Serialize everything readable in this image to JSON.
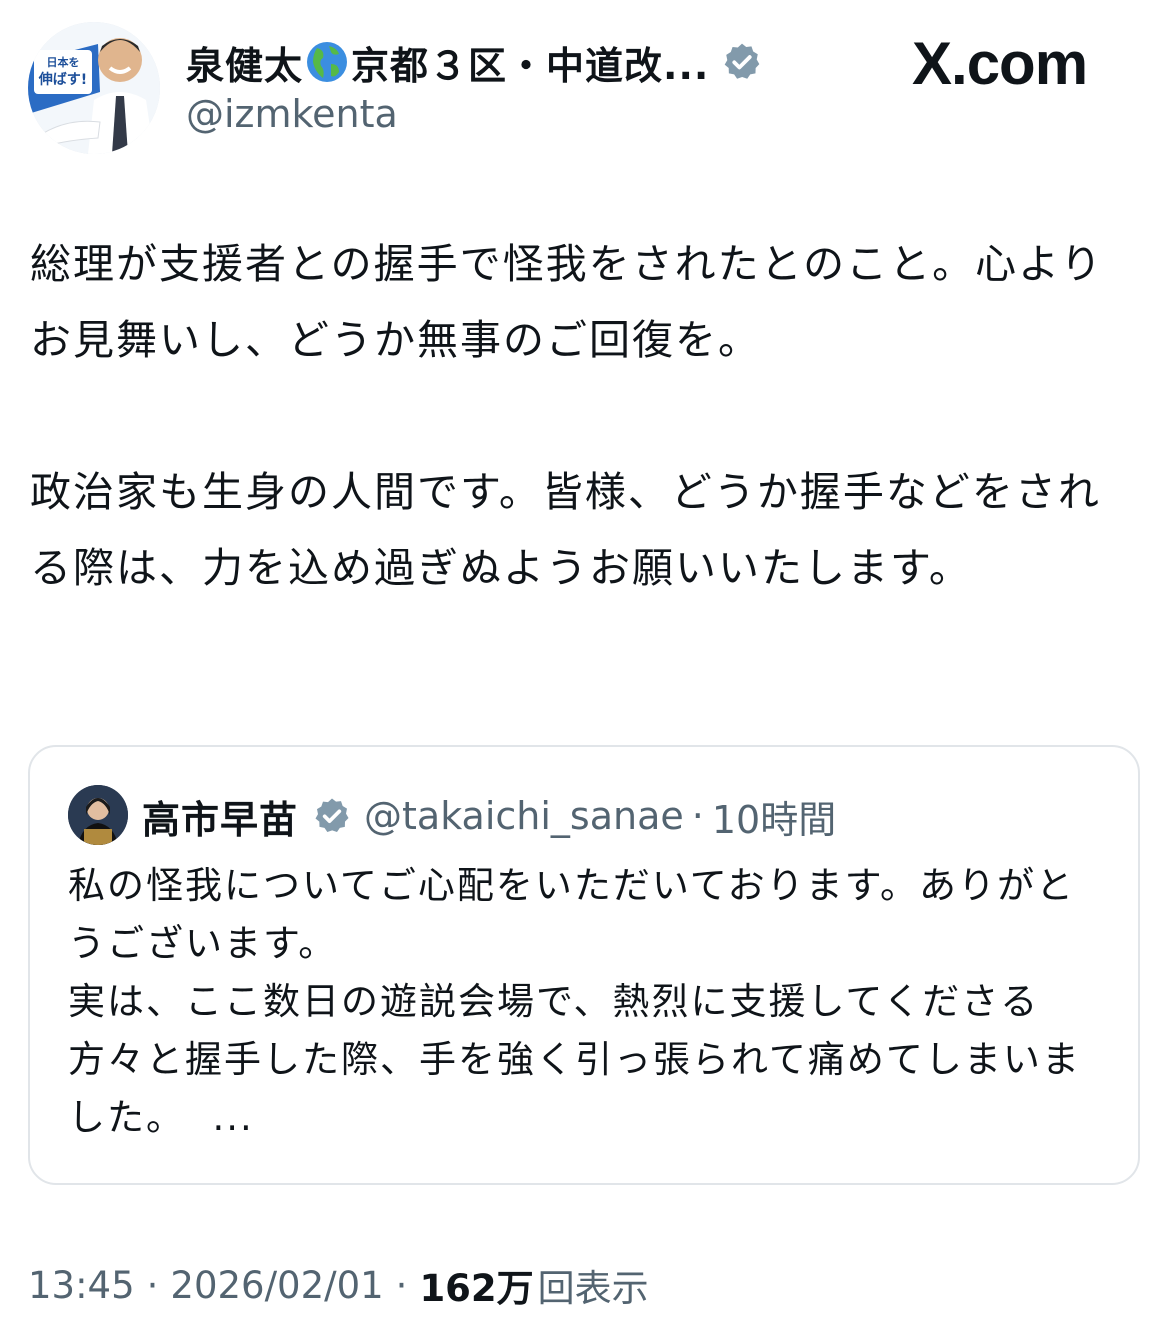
{
  "author": {
    "name_part1": "泉健太",
    "name_part2": "京都３区・中道改...",
    "handle": "@izmkenta",
    "avatar_icon": "profile-photo-icon",
    "avatar_banner_text": "日本を伸ばす!"
  },
  "brand": {
    "domain": "X.com"
  },
  "tweet": {
    "paragraph1": "総理が支援者との握手で怪我をされたとのこと。心よりお見舞いし、どうか無事のご回復を。",
    "paragraph2": "政治家も生身の人間です。皆様、どうか握手などをされる際は、力を込め過ぎぬようお願いいたします。"
  },
  "quoted": {
    "name": "高市早苗",
    "handle": "@takaichi_sanae",
    "separator": "·",
    "time": "10時間",
    "text": "私の怪我についてご心配をいただいております。ありがとうございます。\n実は、ここ数日の遊説会場で、熱烈に支援してくださる方々と握手した際、手を強く引っ張られて痛めてしまいました。",
    "more": "  ..."
  },
  "meta": {
    "time": "13:45",
    "sep1": "·",
    "date": "2026/02/01",
    "sep2": "·",
    "views_count": "162万",
    "views_label": "回表示"
  },
  "colors": {
    "text": "#0f1419",
    "secondary": "#536471",
    "verified": "#829aab",
    "border": "#e1e5e9"
  }
}
